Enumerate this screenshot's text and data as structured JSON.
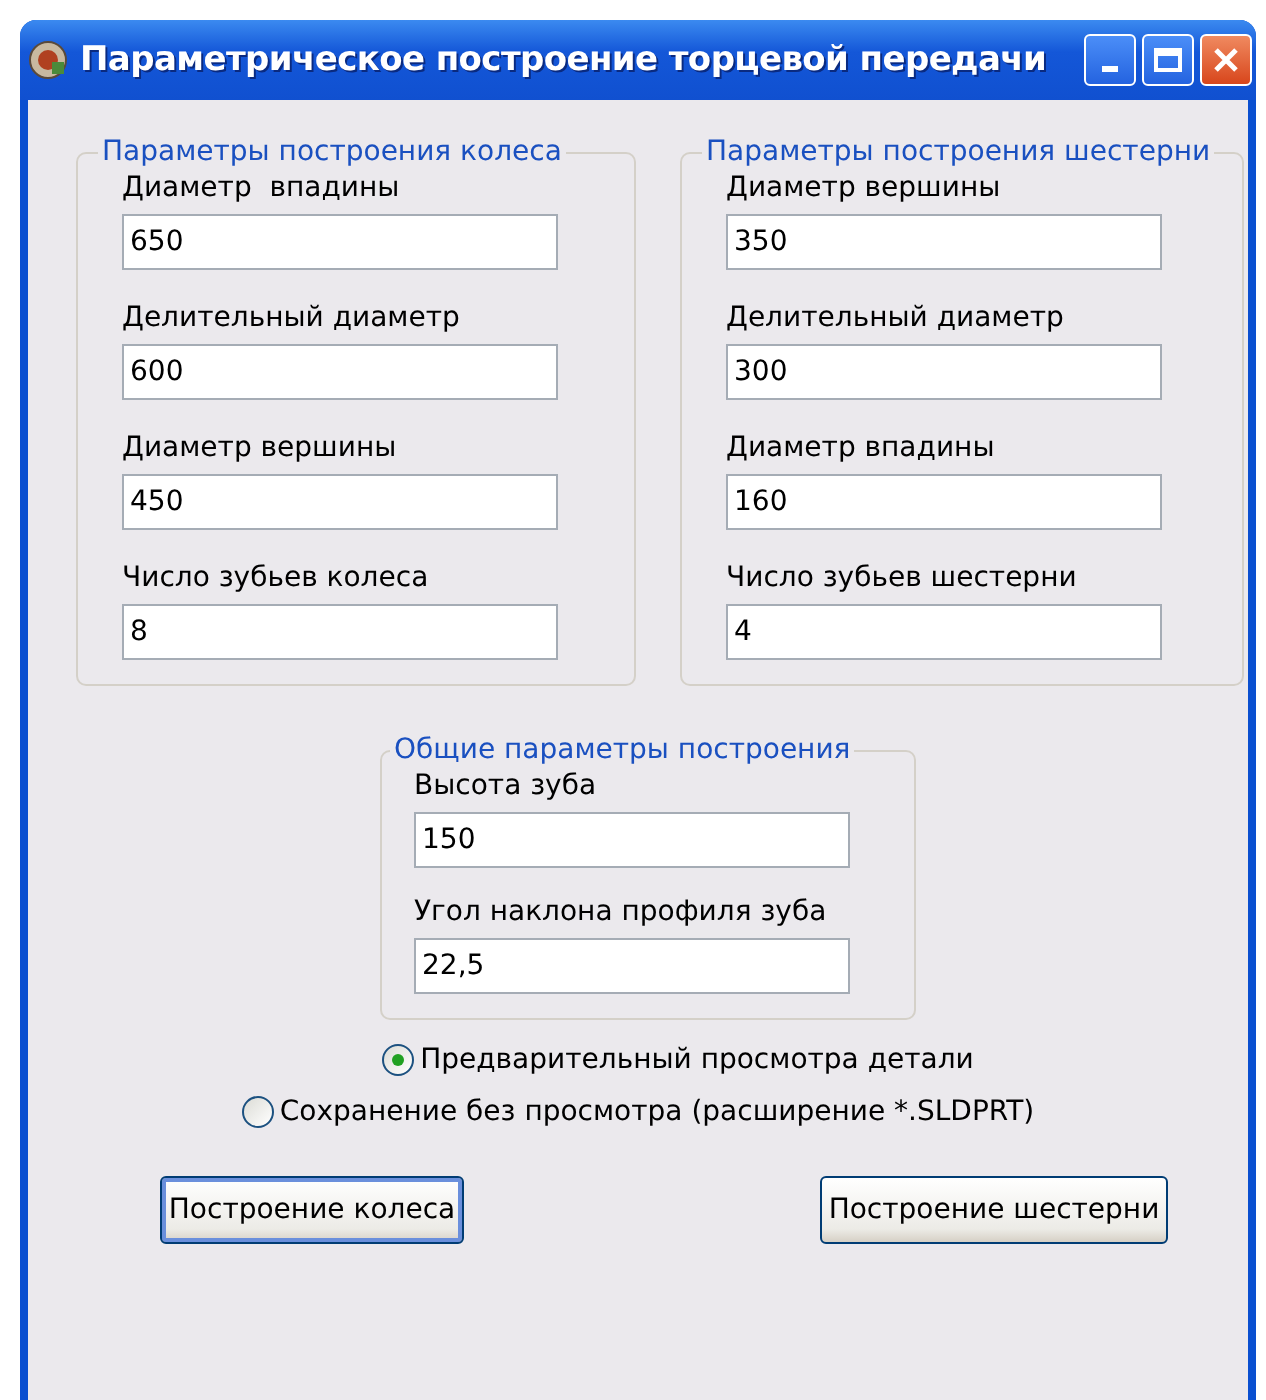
{
  "window": {
    "title": "Параметрическое построение торцевой передачи"
  },
  "groups": [
    {
      "title": "Параметры построения колеса",
      "fields": [
        {
          "label": "Диаметр  впадины",
          "value": "650"
        },
        {
          "label": "Делительный диаметр",
          "value": "600"
        },
        {
          "label": "Диаметр вершины",
          "value": "450"
        },
        {
          "label": "Число зубьев колеса",
          "value": "8"
        }
      ]
    },
    {
      "title": "Параметры построения шестерни",
      "fields": [
        {
          "label": "Диаметр вершины",
          "value": "350"
        },
        {
          "label": "Делительный диаметр",
          "value": "300"
        },
        {
          "label": "Диаметр впадины",
          "value": "160"
        },
        {
          "label": "Число зубьев шестерни",
          "value": "4"
        }
      ]
    }
  ],
  "common": {
    "title": "Общие параметры построения",
    "fields": [
      {
        "label": "Высота зуба",
        "value": "150"
      },
      {
        "label": "Угол наклона профиля зуба",
        "value": "22,5"
      }
    ]
  },
  "options": [
    {
      "label": "Предварительный просмотра детали",
      "selected": true
    },
    {
      "label": "Сохранение без просмотра (расширение *.SLDPRT)",
      "selected": false
    }
  ],
  "buttons": [
    "Построение колеса",
    "Построение шестерни"
  ]
}
